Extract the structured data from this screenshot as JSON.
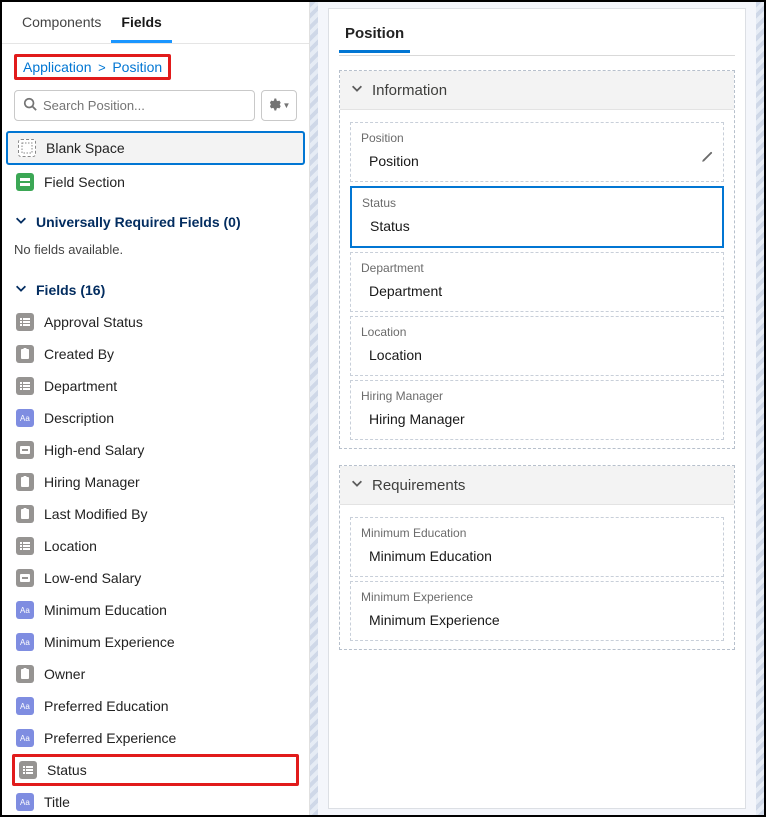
{
  "tabs": {
    "components": "Components",
    "fields": "Fields"
  },
  "breadcrumb": {
    "app": "Application",
    "obj": "Position"
  },
  "search": {
    "placeholder": "Search Position..."
  },
  "palette": {
    "blank_space": "Blank Space",
    "field_section": "Field Section"
  },
  "sections": {
    "required_label": "Universally Required Fields (0)",
    "required_empty": "No fields available.",
    "fields_label": "Fields (16)"
  },
  "fields": [
    {
      "label": "Approval Status",
      "icon": "picklist"
    },
    {
      "label": "Created By",
      "icon": "user"
    },
    {
      "label": "Department",
      "icon": "picklist"
    },
    {
      "label": "Description",
      "icon": "text"
    },
    {
      "label": "High-end Salary",
      "icon": "currency"
    },
    {
      "label": "Hiring Manager",
      "icon": "user"
    },
    {
      "label": "Last Modified By",
      "icon": "user"
    },
    {
      "label": "Location",
      "icon": "picklist"
    },
    {
      "label": "Low-end Salary",
      "icon": "currency"
    },
    {
      "label": "Minimum Education",
      "icon": "text"
    },
    {
      "label": "Minimum Experience",
      "icon": "text"
    },
    {
      "label": "Owner",
      "icon": "user"
    },
    {
      "label": "Preferred Education",
      "icon": "text"
    },
    {
      "label": "Preferred Experience",
      "icon": "text"
    },
    {
      "label": "Status",
      "icon": "picklist",
      "highlight": true
    },
    {
      "label": "Title",
      "icon": "text"
    }
  ],
  "canvas": {
    "object_tab": "Position",
    "sections": [
      {
        "title": "Information",
        "fields": [
          {
            "label": "Position",
            "value": "Position",
            "editable": true
          },
          {
            "label": "Status",
            "value": "Status",
            "selected": true
          },
          {
            "label": "Department",
            "value": "Department"
          },
          {
            "label": "Location",
            "value": "Location"
          },
          {
            "label": "Hiring Manager",
            "value": "Hiring Manager"
          }
        ]
      },
      {
        "title": "Requirements",
        "fields": [
          {
            "label": "Minimum Education",
            "value": "Minimum Education"
          },
          {
            "label": "Minimum Experience",
            "value": "Minimum Experience"
          }
        ]
      }
    ]
  }
}
